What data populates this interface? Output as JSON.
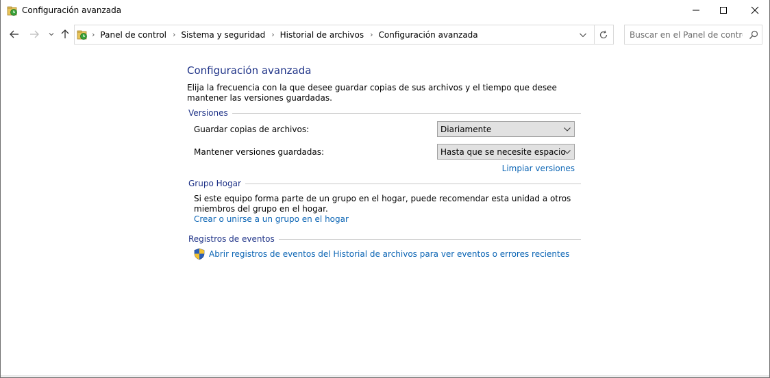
{
  "window": {
    "title": "Configuración avanzada"
  },
  "address": {
    "crumbs": [
      "Panel de control",
      "Sistema y seguridad",
      "Historial de archivos",
      "Configuración avanzada"
    ],
    "sep": "›"
  },
  "search": {
    "placeholder": "Buscar en el Panel de control"
  },
  "page": {
    "title": "Configuración avanzada",
    "intro": "Elija la frecuencia con la que desee guardar copias de sus archivos y el tiempo que desee mantener las versiones guardadas."
  },
  "versions": {
    "header": "Versiones",
    "save_label": "Guardar copias de archivos:",
    "save_value": "Diariamente",
    "keep_label": "Mantener versiones guardadas:",
    "keep_value": "Hasta que se necesite espacio",
    "clean_link": "Limpiar versiones"
  },
  "homegroup": {
    "header": "Grupo Hogar",
    "text": "Si este equipo forma parte de un grupo en el hogar, puede recomendar esta unidad a otros miembros del grupo en el hogar.",
    "link": "Crear o unirse a un grupo en el hogar"
  },
  "events": {
    "header": "Registros de eventos",
    "link": "Abrir registros de eventos del Historial de archivos para ver eventos o errores recientes"
  },
  "colors": {
    "heading_blue": "#1e3287",
    "link_blue": "#0a64b4",
    "select_bg": "#e1e1e1"
  },
  "icons": {
    "app": "file-history-icon",
    "minimize": "minimize-icon",
    "maximize": "maximize-icon",
    "close": "close-icon",
    "back": "arrow-left-icon",
    "forward": "arrow-right-icon",
    "recent": "chevron-down-icon",
    "up": "arrow-up-icon",
    "refresh": "refresh-icon",
    "search": "search-icon",
    "shield": "uac-shield-icon"
  }
}
